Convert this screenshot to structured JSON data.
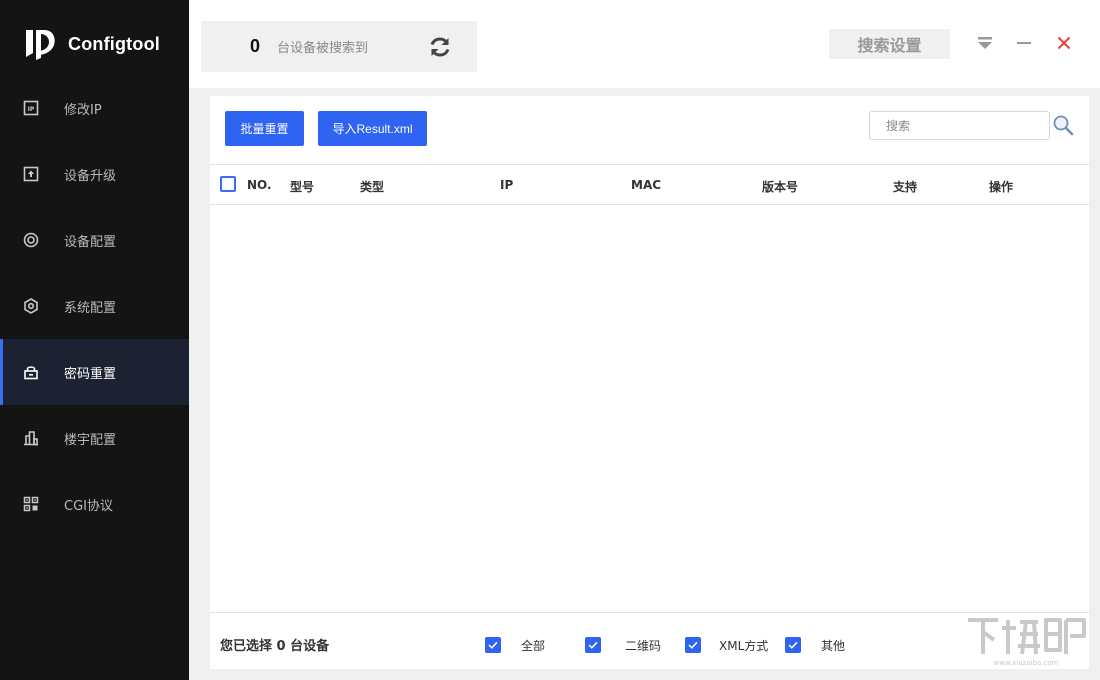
{
  "app": {
    "name": "Configtool"
  },
  "sidebar": {
    "items": [
      {
        "label": "修改IP",
        "icon": "ip-icon"
      },
      {
        "label": "设备升级",
        "icon": "upload-icon"
      },
      {
        "label": "设备配置",
        "icon": "target-icon"
      },
      {
        "label": "系统配置",
        "icon": "hexagon-gear-icon"
      },
      {
        "label": "密码重置",
        "icon": "lock-icon",
        "active": true
      },
      {
        "label": "楼宇配置",
        "icon": "building-icon"
      },
      {
        "label": "CGI协议",
        "icon": "grid-icon"
      }
    ]
  },
  "header": {
    "device_count": "0",
    "device_count_label": "台设备被搜索到",
    "search_settings_label": "搜索设置"
  },
  "toolbar": {
    "batch_reset_label": "批量重置",
    "import_label": "导入Result.xml",
    "search_placeholder": "搜索"
  },
  "table": {
    "columns": [
      "NO.",
      "型号",
      "类型",
      "IP",
      "MAC",
      "版本号",
      "支持",
      "操作"
    ],
    "rows": []
  },
  "footer": {
    "selected_text": "您已选择 0 台设备",
    "filters": [
      {
        "label": "全部",
        "checked": true
      },
      {
        "label": "二维码",
        "checked": true
      },
      {
        "label": "XML方式",
        "checked": true
      },
      {
        "label": "其他",
        "checked": true
      }
    ]
  },
  "colors": {
    "sidebar_bg": "#141414",
    "accent": "#2f63f2",
    "close_red": "#e0413a"
  },
  "watermark": {
    "text": "下载吧",
    "url": "www.xiazaiba.com"
  }
}
